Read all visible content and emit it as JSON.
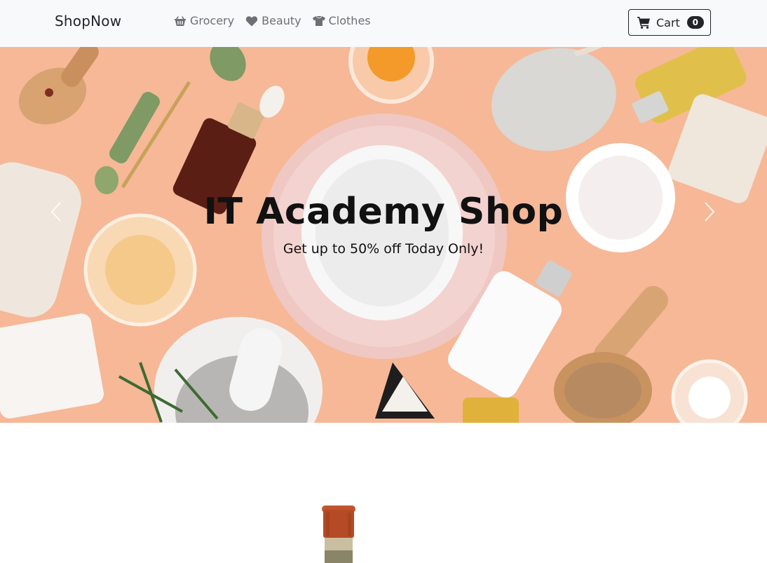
{
  "navbar": {
    "brand": "ShopNow",
    "links": [
      {
        "label": "Grocery",
        "icon": "basket-icon"
      },
      {
        "label": "Beauty",
        "icon": "heart-icon"
      },
      {
        "label": "Clothes",
        "icon": "tshirt-icon"
      }
    ],
    "cart": {
      "label": "Cart",
      "count": "0",
      "icon": "cart-icon"
    }
  },
  "hero": {
    "title": "IT Academy Shop",
    "subtitle": "Get up to 50% off Today Only!",
    "background_color": "#f6b897"
  },
  "colors": {
    "navbar_bg": "#f8f9fa",
    "text_dark": "#212529",
    "link_gray": "#6c6f73"
  }
}
